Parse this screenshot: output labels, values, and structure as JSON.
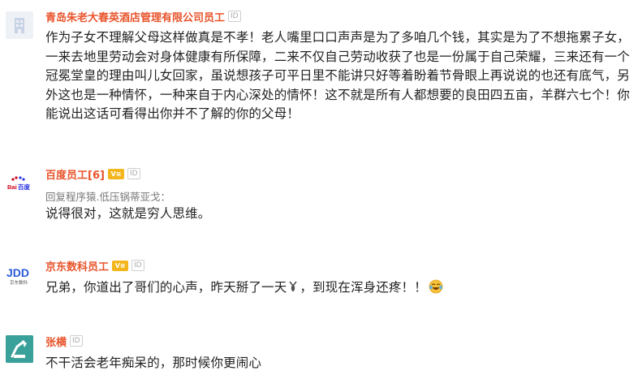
{
  "comments": [
    {
      "author": "青岛朱老大春英酒店管理有限公司员工",
      "id_badge": "ID",
      "text": "作为子女不理解父母这样做真是不孝！老人嘴里口口声声是为了多咱几个钱，其实是为了不想拖累子女，一来去地里劳动会对身体健康有所保障，二来不仅自己劳动收获了也是一份属于自己荣耀，三来还有一个冠冕堂皇的理由叫儿女回家，虽说想孩子可平日里不能讲只好等着盼着节骨眼上再说说的也还有底气，另外这也是一种情怀，一种来自于内心深处的情怀！这不就是所有人都想要的良田四五亩，羊群六七个！你能说出这话可看得出你并不了解的你的父母！"
    },
    {
      "author": "百度员工[6]",
      "v_badge": "V≡",
      "id_badge": "ID",
      "reply_to": "回复程序猿.低压锅蒂亚戈：",
      "text": "说得很对，这就是穷人思维。",
      "avatar_text": "Bai百度"
    },
    {
      "author": "京东数科员工",
      "v_badge": "V≡",
      "id_badge": "ID",
      "text": "兄弟，你道出了哥们的心声，昨天掰了一天",
      "text_after": "，到现在浑身还疼！！",
      "avatar_text": "JDD",
      "avatar_subtext": "京东数科"
    },
    {
      "author": "张横",
      "id_badge": "ID",
      "text": "不干活会老年痴呆的，那时候你更闹心"
    }
  ],
  "colors": {
    "author": "#e8542b",
    "v_badge": "#f3b51b",
    "text": "#222222",
    "reply": "#777777"
  }
}
